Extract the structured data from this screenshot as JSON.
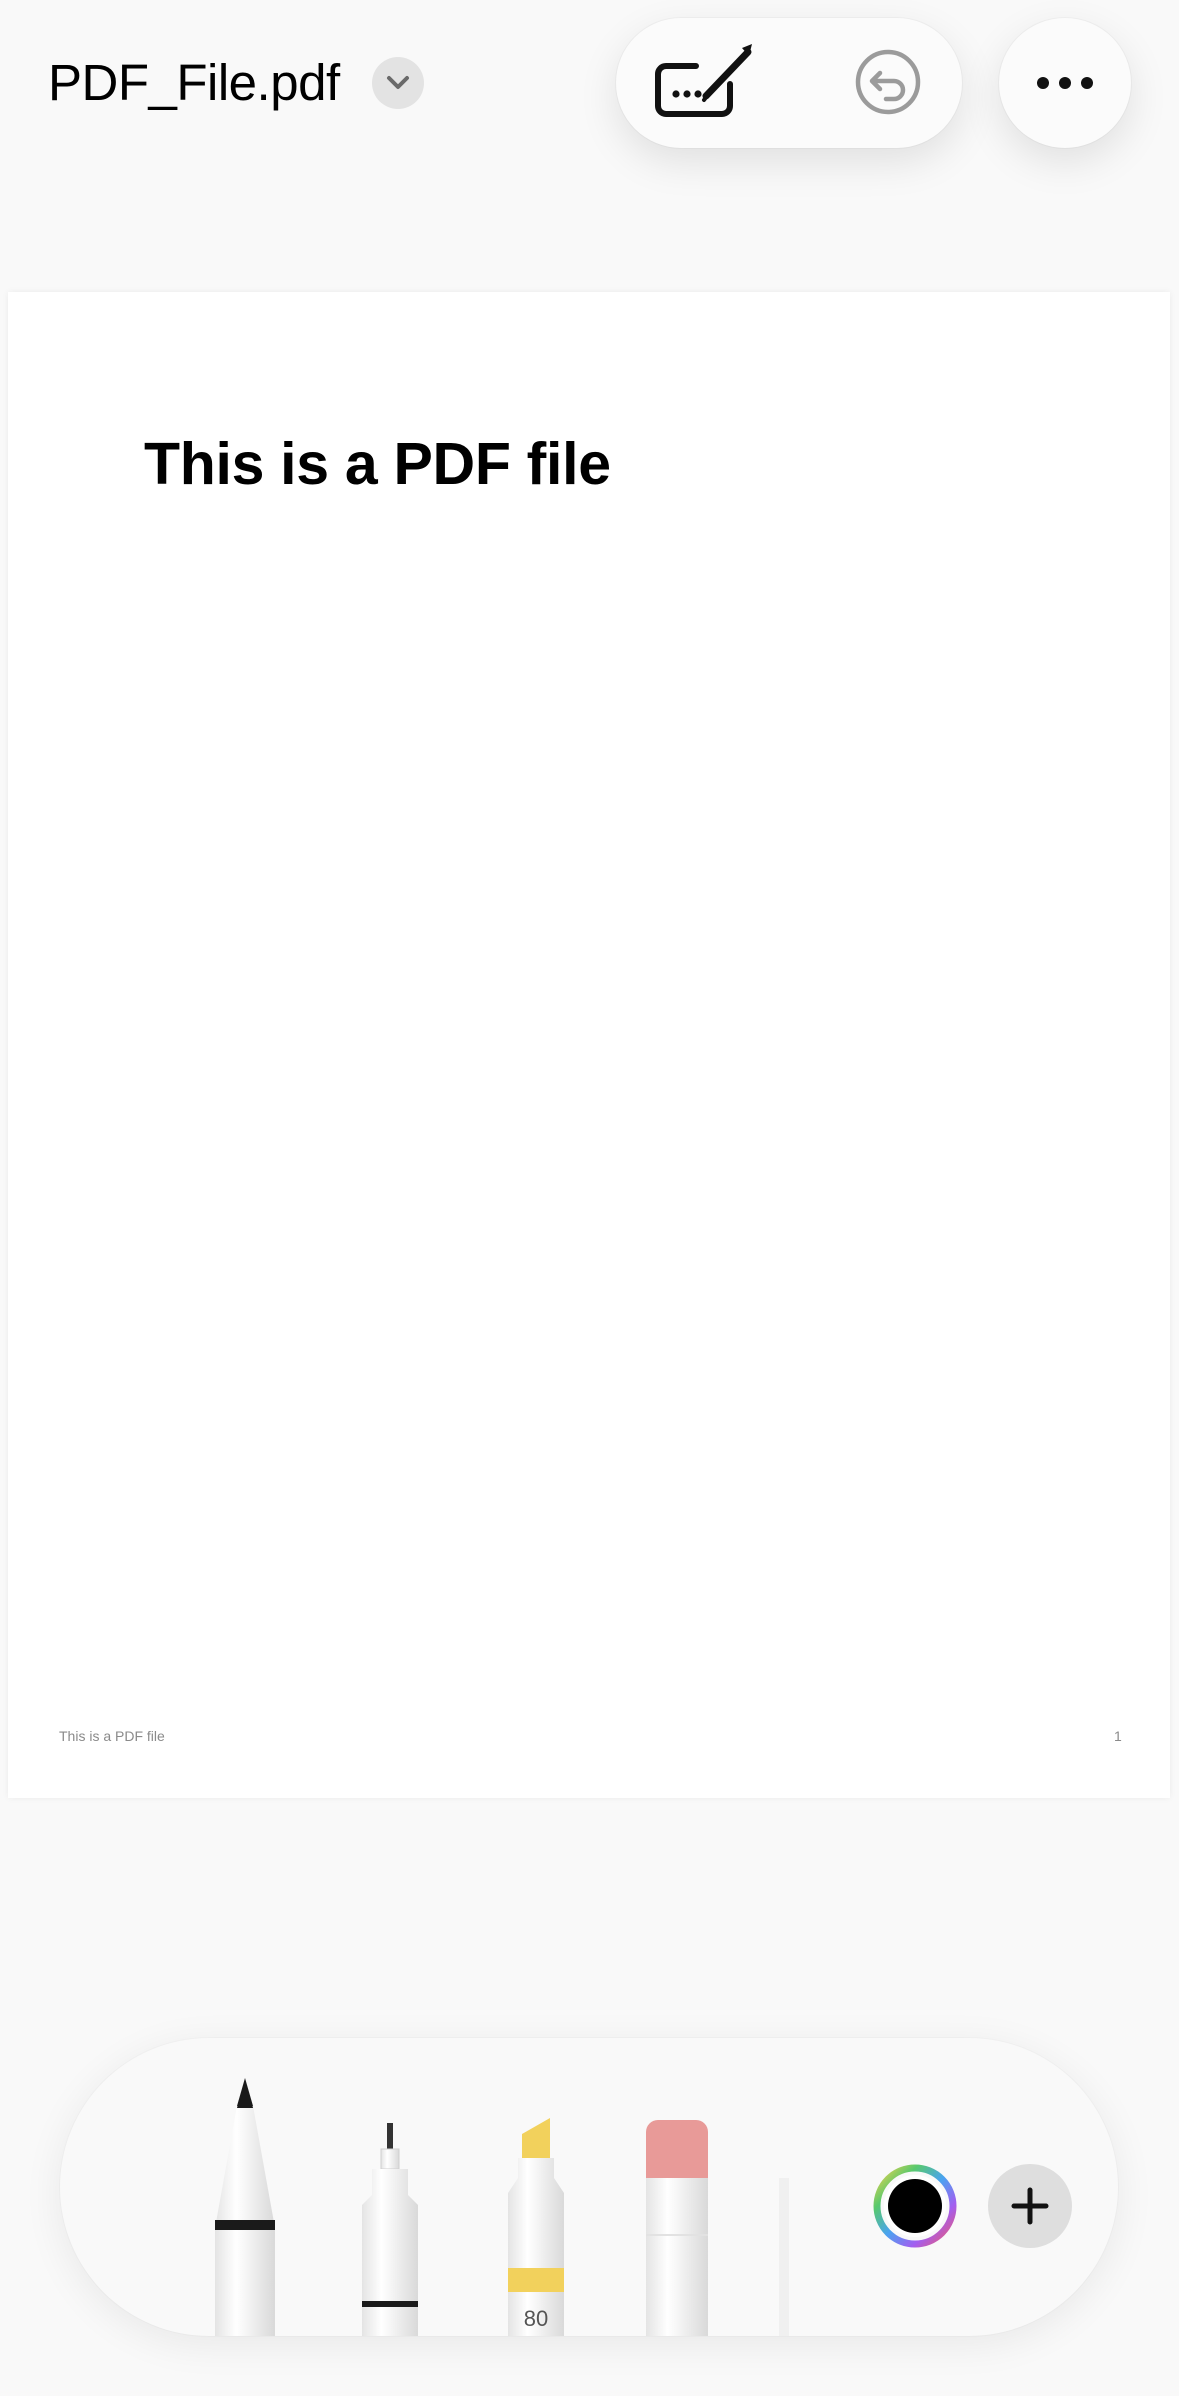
{
  "header": {
    "file_name": "PDF_File.pdf",
    "chevron_icon": "chevron-down-icon",
    "markup_icon": "markup-pen-icon",
    "undo_icon": "undo-icon",
    "more_icon": "ellipsis-icon"
  },
  "document": {
    "heading": "This is a PDF file",
    "footer_text": "This is a PDF file",
    "page_number": "1"
  },
  "palette": {
    "tools": [
      "pen",
      "fineliner",
      "highlighter",
      "eraser",
      "ruler"
    ],
    "highlighter_label": "80",
    "highlighter_color": "#f2d15c",
    "eraser_color": "#e89a98",
    "selected_color": "#000000",
    "add_icon": "plus-icon"
  }
}
